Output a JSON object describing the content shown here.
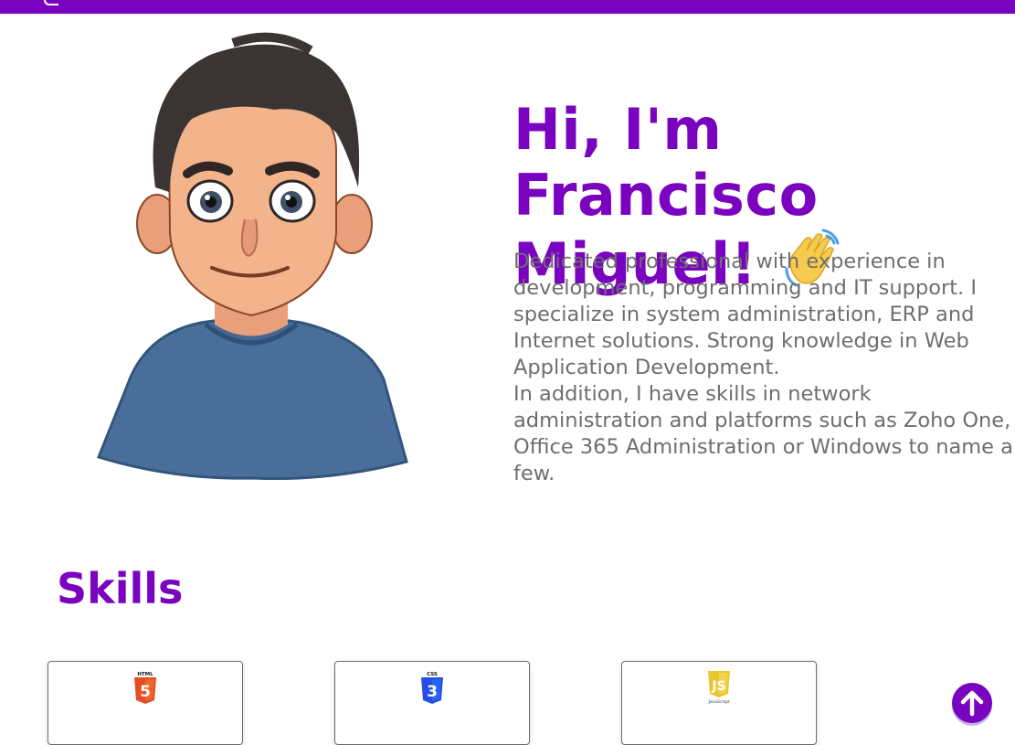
{
  "hero": {
    "title_line1": "Hi, I'm Francisco",
    "title_line2": "Miguel!",
    "wave_icon": "waving-hand-icon",
    "description_p1": "Dedicated professional with experience in development, programming and IT support. I specialize in system administration, ERP and Internet solutions. Strong knowledge in Web Application Development.",
    "description_p2": "In addition, I have skills in network administration and platforms such as Zoho One, Office 365 Administration or Windows to name a few."
  },
  "skills": {
    "title": "Skills",
    "items": [
      {
        "icon": "html5-icon",
        "badge": "HTML",
        "color": "#e44d26"
      },
      {
        "icon": "css3-icon",
        "badge": "CSS",
        "color": "#264de4"
      },
      {
        "icon": "javascript-icon",
        "badge": "JavaScript",
        "color": "#e8c62e"
      }
    ]
  },
  "scroll_top": {
    "icon": "arrow-up-icon"
  },
  "colors": {
    "accent": "#7a03c0",
    "text_muted": "#6e6e6e"
  }
}
